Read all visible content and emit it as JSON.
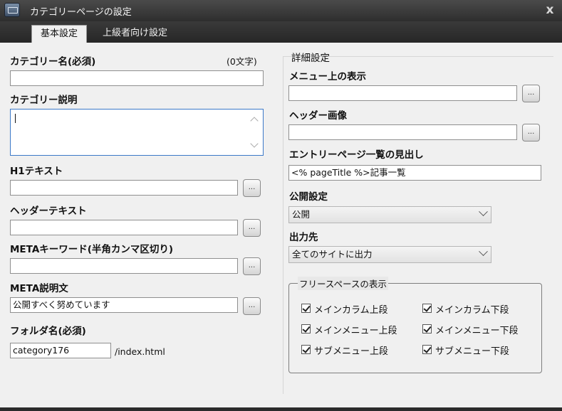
{
  "window": {
    "title": "カテゴリーページの設定",
    "close_glyph": "x"
  },
  "tabs": [
    {
      "label": "基本設定",
      "active": true
    },
    {
      "label": "上級者向け設定",
      "active": false
    }
  ],
  "left": {
    "category_name_label": "カテゴリー名(必須)",
    "char_count": "(0文字)",
    "category_name_value": "",
    "category_desc_label": "カテゴリー説明",
    "category_desc_value": "",
    "h1_label": "H1テキスト",
    "h1_value": "",
    "header_text_label": "ヘッダーテキスト",
    "header_text_value": "",
    "meta_keywords_label": "METAキーワード(半角カンマ区切り)",
    "meta_keywords_value": "",
    "meta_desc_label": "META説明文",
    "meta_desc_value": "公開すべく努めています",
    "folder_label": "フォルダ名(必須)",
    "folder_value": "category176",
    "folder_suffix": "/index.html",
    "browse_label": "..."
  },
  "right": {
    "section_title": "詳細設定",
    "menu_display_label": "メニュー上の表示",
    "menu_display_value": "",
    "header_image_label": "ヘッダー画像",
    "header_image_value": "",
    "entry_heading_label": "エントリーページ一覧の見出し",
    "entry_heading_value": "<% pageTitle %>記事一覧",
    "publish_label": "公開設定",
    "publish_value": "公開",
    "output_label": "出力先",
    "output_value": "全てのサイトに出力",
    "freespace_title": "フリースペースの表示",
    "checkboxes": [
      {
        "label": "メインカラム上段",
        "checked": true
      },
      {
        "label": "メインカラム下段",
        "checked": true
      },
      {
        "label": "メインメニュー上段",
        "checked": true
      },
      {
        "label": "メインメニュー下段",
        "checked": true
      },
      {
        "label": "サブメニュー上段",
        "checked": true
      },
      {
        "label": "サブメニュー下段",
        "checked": true
      }
    ]
  },
  "icons": {
    "app": "app-window-icon",
    "close": "close-icon",
    "browse": "ellipsis-icon",
    "dropdown": "chevron-down-icon",
    "checkbox": "checkmark-icon"
  },
  "colors": {
    "titlebar": "#3a3a3a",
    "content_bg": "#f0f0f0",
    "focus_border": "#3b79c8"
  }
}
